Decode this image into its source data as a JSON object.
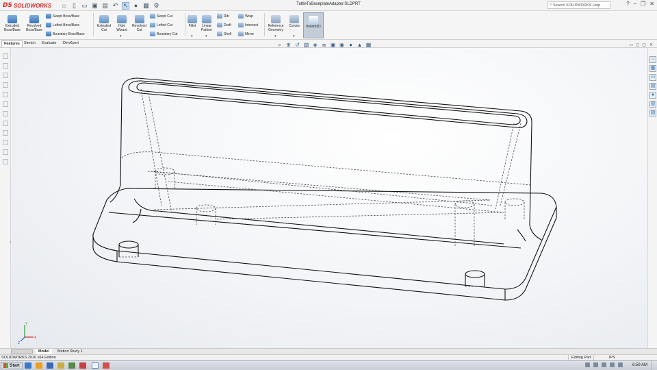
{
  "app": {
    "brand_ds": "DS",
    "brand_name": "SOLIDWORKS"
  },
  "window": {
    "doc_title": "TuttleToBaseplateAdaptor.SLDPRT",
    "help_search": "Search SOLIDWORKS Help"
  },
  "ribbon": {
    "extruded_boss": [
      "Extruded",
      "Boss/Base"
    ],
    "revolved_boss": [
      "Revolved",
      "Boss/Base"
    ],
    "swept_boss": "Swept Boss/Base",
    "lofted_boss": "Lofted Boss/Base",
    "boundary_boss": "Boundary Boss/Base",
    "extruded_cut": [
      "Extruded",
      "Cut"
    ],
    "hole_wizard": [
      "Hole",
      "Wizard"
    ],
    "revolved_cut": [
      "Revolved",
      "Cut"
    ],
    "swept_cut": "Swept Cut",
    "lofted_cut": "Lofted Cut",
    "boundary_cut": "Boundary Cut",
    "fillet": "Fillet",
    "linear_pattern": [
      "Linear",
      "Pattern"
    ],
    "rib": "Rib",
    "draft": "Draft",
    "shell": "Shell",
    "wrap": "Wrap",
    "intersect": "Intersect",
    "mirror": "Mirror",
    "reference_geometry": [
      "Reference",
      "Geometry"
    ],
    "curves": "Curves",
    "instant3d": "Instant3D"
  },
  "command_tabs": [
    "Features",
    "Sketch",
    "Evaluate",
    "DimXpert"
  ],
  "active_command_tab": "Features",
  "bottom_tabs": [
    "Model",
    "Motion Study 1"
  ],
  "status": {
    "edition": "SOLIDWORKS 2016 x64 Edition",
    "mode": "Editing Part",
    "units": "IPS"
  },
  "taskbar": {
    "start": "Start",
    "clock": "6:59 AM"
  },
  "triad": {
    "x": "X",
    "y": "Y",
    "z": "Z"
  },
  "colors": {
    "brand": "#d62b26",
    "axis_x": "#d62b26",
    "axis_y": "#2e9a3a",
    "axis_z": "#2a55c8",
    "edge": "#111111"
  }
}
